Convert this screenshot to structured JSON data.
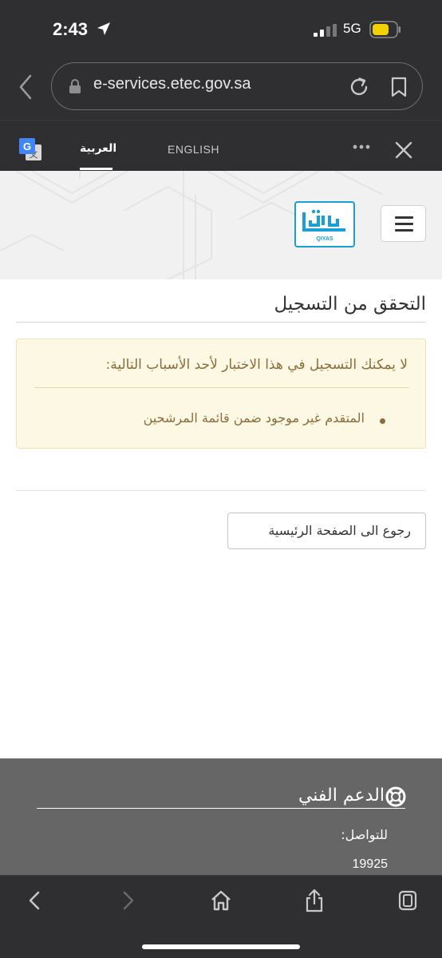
{
  "status_bar": {
    "time": "2:43",
    "network": "5G",
    "battery_color": "#f5d000"
  },
  "browser": {
    "url": "e-services.etec.gov.sa"
  },
  "translate_bar": {
    "lang_arabic": "العربية",
    "lang_english": "ENGLISH",
    "selected": "العربية"
  },
  "header": {
    "logo_text": "QIYAS"
  },
  "main": {
    "title": "التحقق من التسجيل",
    "alert_heading": "لا يمكنك التسجيل في هذا الاختبار لأحد الأسباب التالية:",
    "alert_items": [
      "المتقدم غير موجود ضمن قائمة المرشحين"
    ],
    "home_button": "رجوع الى الصفحة الرئيسية",
    "alert_text_color": "#8a6d3b",
    "alert_bg_color": "#fcf8e3"
  },
  "footer": {
    "support_title": "الدعم الفني",
    "contact_label": "للتواصل:",
    "contact_number": "19925"
  },
  "icons": {
    "status": [
      "location-arrow-icon",
      "signal-icon",
      "battery-icon"
    ],
    "browser": [
      "back-icon",
      "lock-icon",
      "reload-icon",
      "bookmark-icon"
    ],
    "translate": [
      "google-translate-icon",
      "more-icon",
      "close-icon"
    ],
    "toolbar": [
      "back-icon",
      "forward-icon",
      "home-icon",
      "share-icon",
      "tabs-icon"
    ]
  }
}
